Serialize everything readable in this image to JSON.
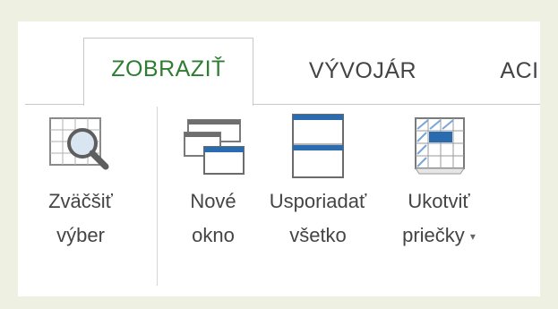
{
  "tabs": [
    {
      "label": "ZOBRAZIŤ",
      "active": true
    },
    {
      "label": "VÝVOJÁR",
      "active": false
    },
    {
      "label": "ACI",
      "active": false
    }
  ],
  "commands": [
    {
      "line1": "Zväčšiť",
      "line2": "výber",
      "icon": "zoom-to-selection-icon"
    },
    {
      "line1": "Nové",
      "line2": "okno",
      "icon": "new-window-icon"
    },
    {
      "line1": "Usporiadať",
      "line2": "všetko",
      "icon": "arrange-all-icon"
    },
    {
      "line1": "Ukotviť",
      "line2": "priečky",
      "icon": "freeze-panes-icon",
      "dropdown": true
    }
  ],
  "colors": {
    "accent_green": "#2e7d32",
    "accent_blue": "#2b6cb0",
    "text": "#444444",
    "background": "#eef1e1"
  }
}
